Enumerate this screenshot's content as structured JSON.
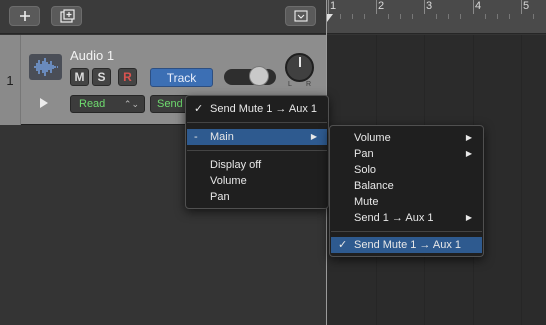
{
  "toolbar": {
    "add_icon": "plus-icon",
    "new_track_icon": "new-track-icon",
    "collapse_icon": "collapse-icon"
  },
  "track": {
    "number": "1",
    "name": "Audio 1",
    "icon": "waveform-icon",
    "mute_label": "M",
    "solo_label": "S",
    "record_label": "R",
    "track_button_label": "Track",
    "pan_left": "L",
    "pan_right": "R",
    "automation_mode": "Read",
    "automation_param": "Send"
  },
  "ruler": {
    "bars": [
      "1",
      "2",
      "3",
      "4",
      "5"
    ]
  },
  "menu_primary": {
    "items": [
      {
        "label": "Send Mute 1 → Aux 1",
        "checked": true
      },
      {
        "label": "Main",
        "mark": "-",
        "submenu": true,
        "highlighted": true
      },
      {
        "label": "Display off"
      },
      {
        "label": "Volume"
      },
      {
        "label": "Pan"
      }
    ]
  },
  "menu_submenu": {
    "items": [
      {
        "label": "Volume",
        "submenu": true
      },
      {
        "label": "Pan",
        "submenu": true
      },
      {
        "label": "Solo"
      },
      {
        "label": "Balance"
      },
      {
        "label": "Mute"
      },
      {
        "label": "Send 1 → Aux 1",
        "submenu": true
      },
      {
        "label": "Send Mute 1 → Aux 1",
        "checked": true,
        "highlighted": true
      }
    ]
  },
  "colors": {
    "selection": "#2e5a8f",
    "track_button": "#3c6fb4",
    "automation_text": "#6fdc6f",
    "record": "#d9534f"
  }
}
